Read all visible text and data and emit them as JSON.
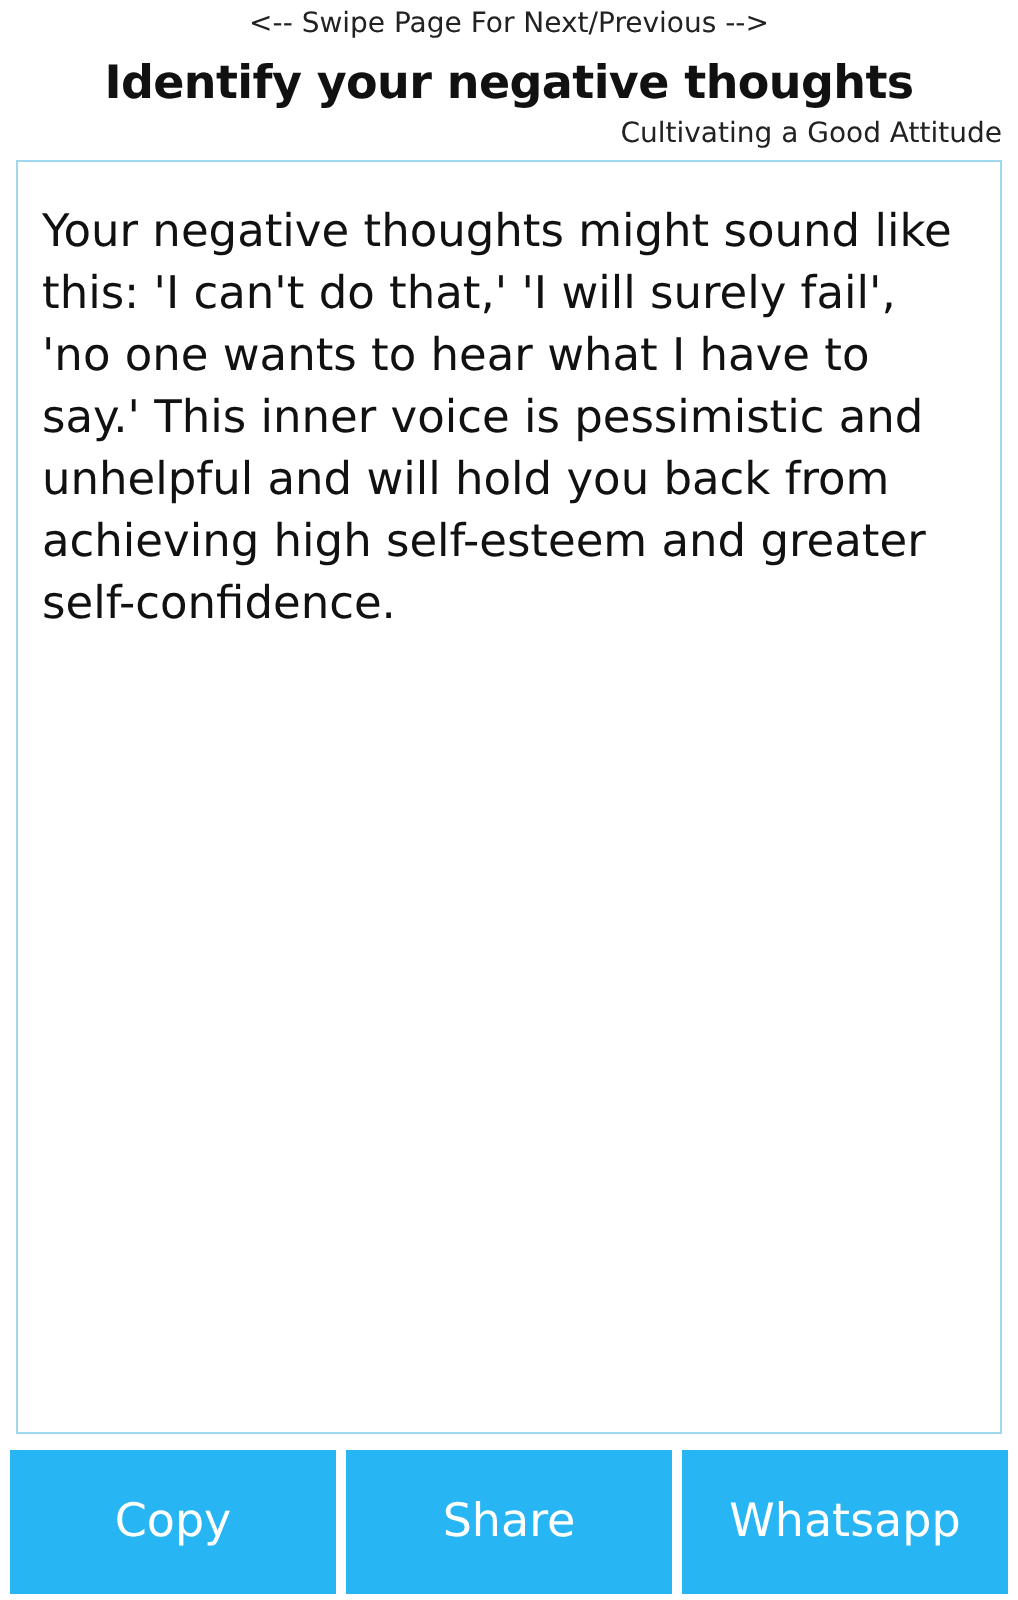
{
  "hint": "<-- Swipe Page For Next/Previous -->",
  "title": "Identify your negative thoughts",
  "subtitle": "Cultivating a Good Attitude",
  "body": "Your negative thoughts might sound like this: 'I can't do that,' 'I will surely fail', 'no one wants to hear what I have to say.' This inner voice is pessimistic and unhelpful and will hold you back from achieving high self-esteem and greater self-confidence.",
  "buttons": [
    "Copy",
    "Share",
    "Whatsapp"
  ]
}
